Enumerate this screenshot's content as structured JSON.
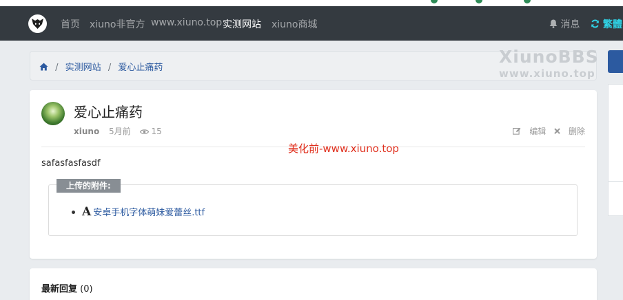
{
  "nav": {
    "links": [
      "首页",
      "xiuno非官方",
      "www.xiuno.top",
      "实测网站",
      "xiuno商城"
    ],
    "active_index": 3,
    "messages_label": "消息",
    "traditional_label": "繁體"
  },
  "breadcrumb": {
    "home_icon": "home-icon",
    "items": [
      "实测网站",
      "爱心止痛药"
    ]
  },
  "watermark": {
    "line1": "XiunoBBS",
    "line2": "www.xiuno.top"
  },
  "post": {
    "title": "爱心止痛药",
    "author": "xiuno",
    "time": "5月前",
    "views": "15",
    "edit_label": "编辑",
    "delete_label": "删除",
    "overlay_note": "美化前-www.xiuno.top",
    "content": "safasfasfasdf",
    "attachments_label": "上传的附件:",
    "attachments": [
      {
        "icon": "font-file-icon",
        "name": "安卓手机字体萌妹爱蕾丝.ttf"
      }
    ]
  },
  "replies": {
    "title": "最新回复",
    "count": "(0)"
  },
  "colors": {
    "navbar": "#343a40",
    "accent_blue": "#2c5aa0",
    "overlay_red": "#e0301e",
    "traditional_cyan": "#2fd3e6"
  }
}
